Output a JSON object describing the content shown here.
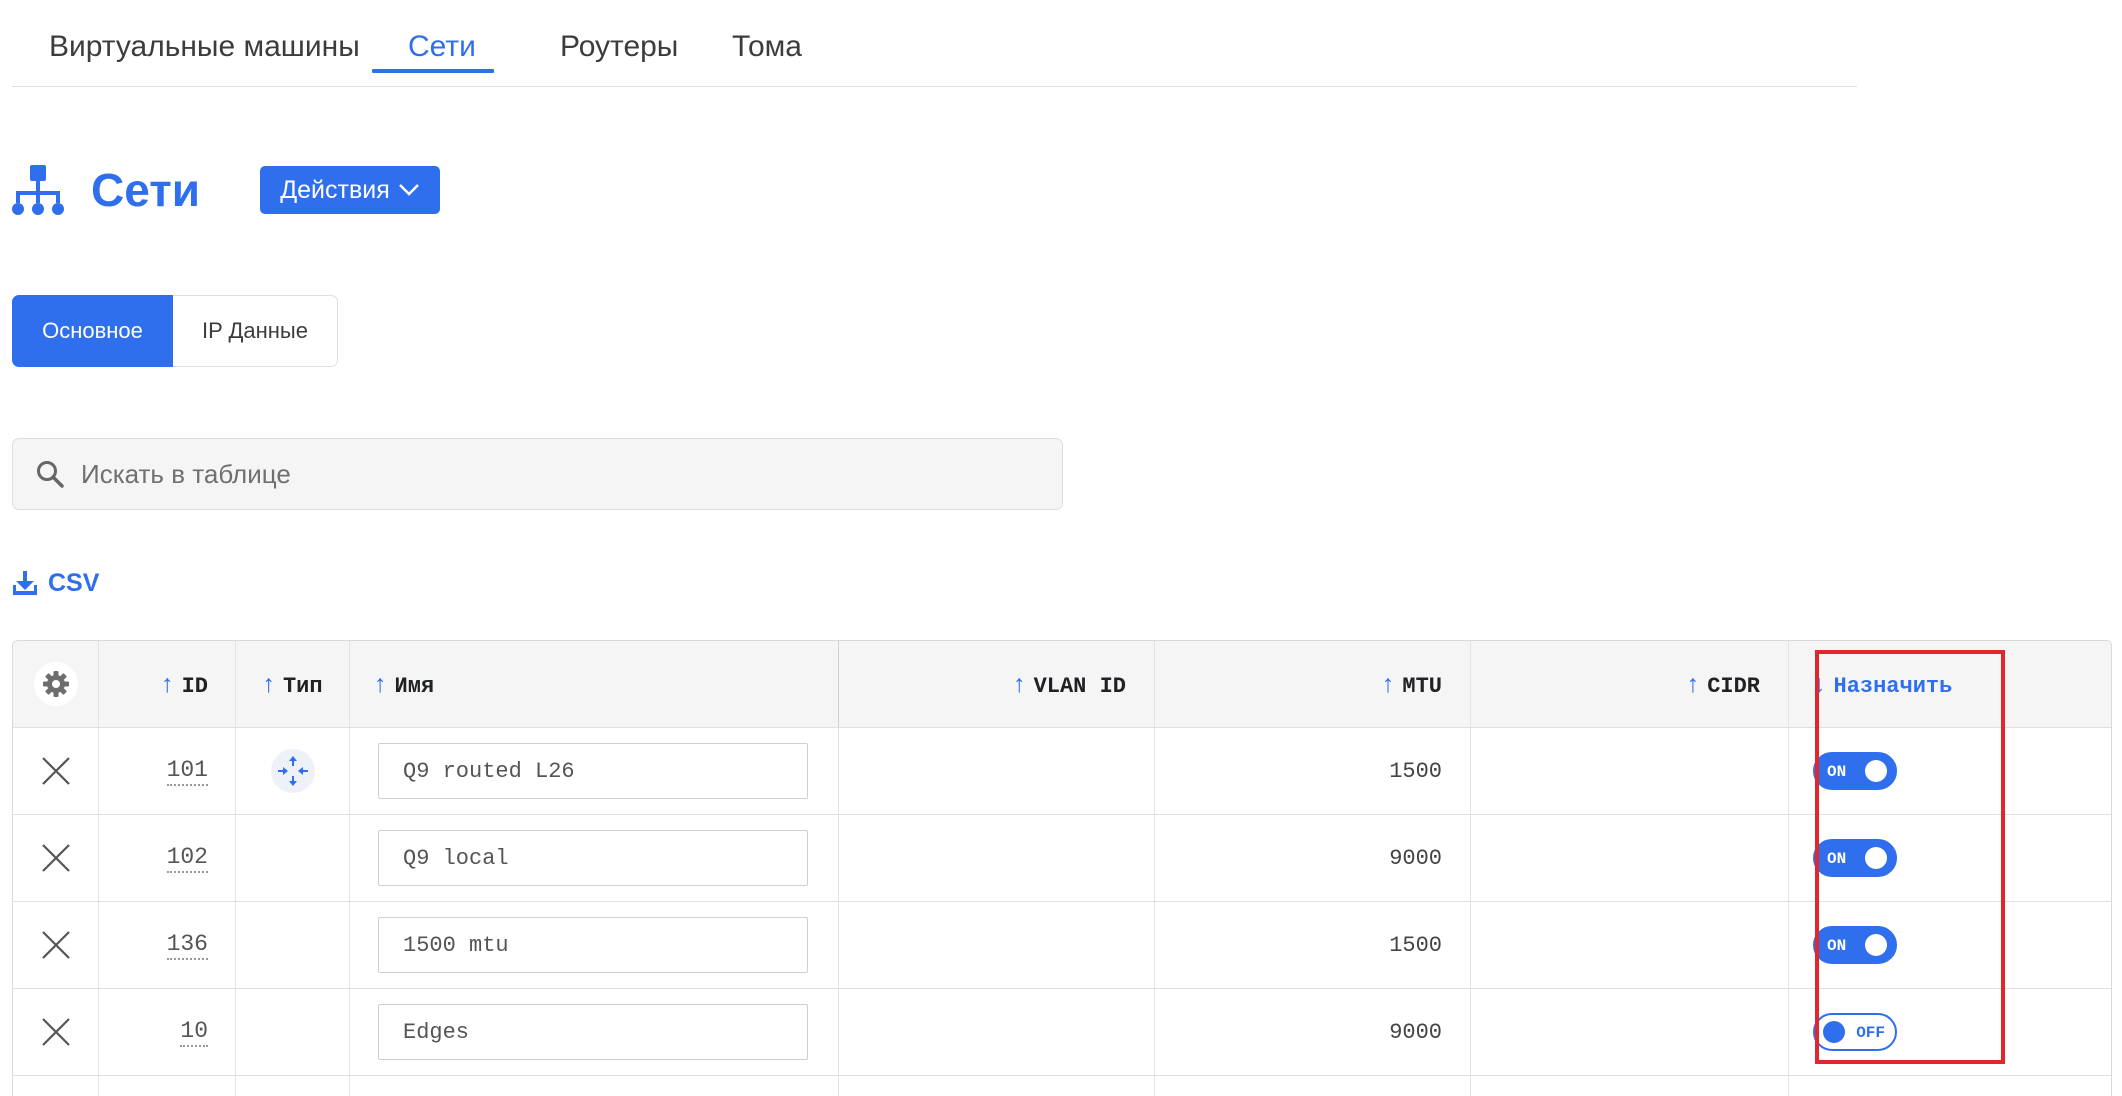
{
  "tabs": [
    {
      "label": "Виртуальные машины"
    },
    {
      "label": "Сети"
    },
    {
      "label": "Роутеры"
    },
    {
      "label": "Тома"
    }
  ],
  "page": {
    "title": "Сети",
    "actions_label": "Действия"
  },
  "segments": [
    {
      "label": "Основное"
    },
    {
      "label": "IP Данные"
    }
  ],
  "search": {
    "placeholder": "Искать в таблице"
  },
  "csv_label": "CSV",
  "colors": {
    "accent": "#2f6fed",
    "highlight": "#e3262b"
  },
  "table": {
    "columns": [
      {
        "label": ""
      },
      {
        "label": "ID"
      },
      {
        "label": "Тип"
      },
      {
        "label": "Имя"
      },
      {
        "label": "VLAN ID"
      },
      {
        "label": "MTU"
      },
      {
        "label": "CIDR"
      },
      {
        "label": "Назначить"
      }
    ],
    "rows": [
      {
        "id": "101",
        "type_icon": "router-type-icon",
        "name": "Q9 routed L26",
        "vlan_id": "",
        "mtu": "1500",
        "cidr": "",
        "assign": "ON"
      },
      {
        "id": "102",
        "type_icon": "",
        "name": "Q9 local",
        "vlan_id": "",
        "mtu": "9000",
        "cidr": "",
        "assign": "ON"
      },
      {
        "id": "136",
        "type_icon": "",
        "name": "1500 mtu",
        "vlan_id": "",
        "mtu": "1500",
        "cidr": "",
        "assign": "ON"
      },
      {
        "id": "10",
        "type_icon": "",
        "name": "Edges",
        "vlan_id": "",
        "mtu": "9000",
        "cidr": "",
        "assign": "OFF"
      }
    ]
  }
}
